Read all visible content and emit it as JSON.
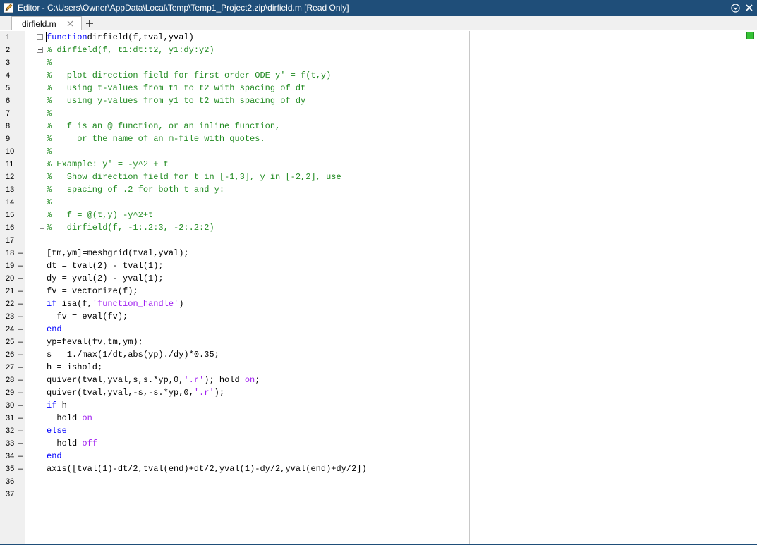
{
  "window": {
    "title": "Editor - C:\\Users\\Owner\\AppData\\Local\\Temp\\Temp1_Project2.zip\\dirfield.m [Read Only]"
  },
  "tabs": [
    {
      "label": "dirfield.m",
      "active": true
    }
  ],
  "icons": {
    "app": "editor-pencil-icon",
    "menu": "circle-chevron-down-icon",
    "close_window": "close-icon",
    "close_tab": "close-icon",
    "add_tab": "plus-icon"
  },
  "colors": {
    "keyword": "#0000ff",
    "comment": "#228b22",
    "string": "#a020f0",
    "titlebar": "#1f4e79",
    "status_ok": "#36c236"
  },
  "code_lines": [
    {
      "n": "1",
      "exec": false,
      "segs": [
        [
          "kw",
          "function"
        ],
        [
          "",
          "dirfield(f,tval,yval)"
        ]
      ]
    },
    {
      "n": "2",
      "exec": false,
      "segs": [
        [
          "cm",
          "% dirfield(f, t1:dt:t2, y1:dy:y2)"
        ]
      ]
    },
    {
      "n": "3",
      "exec": false,
      "segs": [
        [
          "cm",
          "%"
        ]
      ]
    },
    {
      "n": "4",
      "exec": false,
      "segs": [
        [
          "cm",
          "%   plot direction field for first order ODE y' = f(t,y)"
        ]
      ]
    },
    {
      "n": "5",
      "exec": false,
      "segs": [
        [
          "cm",
          "%   using t-values from t1 to t2 with spacing of dt"
        ]
      ]
    },
    {
      "n": "6",
      "exec": false,
      "segs": [
        [
          "cm",
          "%   using y-values from y1 to t2 with spacing of dy"
        ]
      ]
    },
    {
      "n": "7",
      "exec": false,
      "segs": [
        [
          "cm",
          "%"
        ]
      ]
    },
    {
      "n": "8",
      "exec": false,
      "segs": [
        [
          "cm",
          "%   f is an @ function, or an inline function,"
        ]
      ]
    },
    {
      "n": "9",
      "exec": false,
      "segs": [
        [
          "cm",
          "%     or the name of an m-file with quotes."
        ]
      ]
    },
    {
      "n": "10",
      "exec": false,
      "segs": [
        [
          "cm",
          "%"
        ]
      ]
    },
    {
      "n": "11",
      "exec": false,
      "segs": [
        [
          "cm",
          "% Example: y' = -y^2 + t"
        ]
      ]
    },
    {
      "n": "12",
      "exec": false,
      "segs": [
        [
          "cm",
          "%   Show direction field for t in [-1,3], y in [-2,2], use"
        ]
      ]
    },
    {
      "n": "13",
      "exec": false,
      "segs": [
        [
          "cm",
          "%   spacing of .2 for both t and y:"
        ]
      ]
    },
    {
      "n": "14",
      "exec": false,
      "segs": [
        [
          "cm",
          "%"
        ]
      ]
    },
    {
      "n": "15",
      "exec": false,
      "segs": [
        [
          "cm",
          "%   f = @(t,y) -y^2+t"
        ]
      ]
    },
    {
      "n": "16",
      "exec": false,
      "segs": [
        [
          "cm",
          "%   dirfield(f, -1:.2:3, -2:.2:2)"
        ]
      ]
    },
    {
      "n": "17",
      "exec": false,
      "segs": []
    },
    {
      "n": "18",
      "exec": true,
      "segs": [
        [
          "",
          "[tm,ym]=meshgrid(tval,yval);"
        ]
      ]
    },
    {
      "n": "19",
      "exec": true,
      "segs": [
        [
          "",
          "dt = tval(2) - tval(1);"
        ]
      ]
    },
    {
      "n": "20",
      "exec": true,
      "segs": [
        [
          "",
          "dy = yval(2) - yval(1);"
        ]
      ]
    },
    {
      "n": "21",
      "exec": true,
      "segs": [
        [
          "",
          "fv = vectorize(f);"
        ]
      ]
    },
    {
      "n": "22",
      "exec": true,
      "segs": [
        [
          "kw",
          "if"
        ],
        [
          "",
          " isa(f,"
        ],
        [
          "st",
          "'function_handle'"
        ],
        [
          "",
          ")"
        ]
      ]
    },
    {
      "n": "23",
      "exec": true,
      "segs": [
        [
          "",
          "  fv = eval(fv);"
        ]
      ]
    },
    {
      "n": "24",
      "exec": true,
      "segs": [
        [
          "kw",
          "end"
        ]
      ]
    },
    {
      "n": "25",
      "exec": true,
      "segs": [
        [
          "",
          "yp=feval(fv,tm,ym);"
        ]
      ]
    },
    {
      "n": "26",
      "exec": true,
      "segs": [
        [
          "",
          "s = 1./max(1/dt,abs(yp)./dy)*0.35;"
        ]
      ]
    },
    {
      "n": "27",
      "exec": true,
      "segs": [
        [
          "",
          "h = ishold;"
        ]
      ]
    },
    {
      "n": "28",
      "exec": true,
      "segs": [
        [
          "",
          "quiver(tval,yval,s,s.*yp,0,"
        ],
        [
          "st",
          "'.r'"
        ],
        [
          "",
          "); hold "
        ],
        [
          "st",
          "on"
        ],
        [
          "",
          ";"
        ]
      ]
    },
    {
      "n": "29",
      "exec": true,
      "segs": [
        [
          "",
          "quiver(tval,yval,-s,-s.*yp,0,"
        ],
        [
          "st",
          "'.r'"
        ],
        [
          "",
          ");"
        ]
      ]
    },
    {
      "n": "30",
      "exec": true,
      "segs": [
        [
          "kw",
          "if"
        ],
        [
          "",
          " h"
        ]
      ]
    },
    {
      "n": "31",
      "exec": true,
      "segs": [
        [
          "",
          "  hold "
        ],
        [
          "st",
          "on"
        ]
      ]
    },
    {
      "n": "32",
      "exec": true,
      "segs": [
        [
          "kw",
          "else"
        ]
      ]
    },
    {
      "n": "33",
      "exec": true,
      "segs": [
        [
          "",
          "  hold "
        ],
        [
          "st",
          "off"
        ]
      ]
    },
    {
      "n": "34",
      "exec": true,
      "segs": [
        [
          "kw",
          "end"
        ]
      ]
    },
    {
      "n": "35",
      "exec": true,
      "segs": [
        [
          "",
          "axis([tval(1)-dt/2,tval(end)+dt/2,yval(1)-dy/2,yval(end)+dy/2])"
        ]
      ]
    },
    {
      "n": "36",
      "exec": false,
      "segs": []
    },
    {
      "n": "37",
      "exec": false,
      "segs": []
    }
  ]
}
